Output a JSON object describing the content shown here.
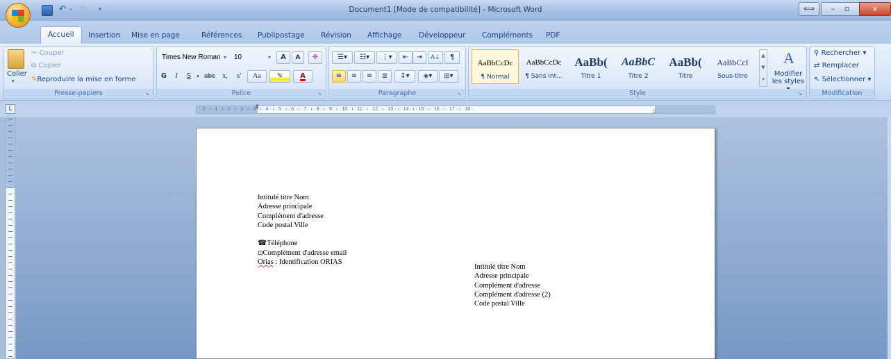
{
  "window": {
    "title": "Document1 [Mode de compatibilité] - Microsoft Word",
    "controls": {
      "restore": "⟺",
      "minimize": "–",
      "maximize": "▫",
      "close": "x"
    }
  },
  "tabs": [
    "Accueil",
    "Insertion",
    "Mise en page",
    "Références",
    "Publipostage",
    "Révision",
    "Affichage",
    "Développeur",
    "Compléments",
    "PDF"
  ],
  "clipboard": {
    "paste": "Coller",
    "cut": "Couper",
    "copy": "Copier",
    "format_painter": "Reproduire la mise en forme",
    "label": "Presse-papiers"
  },
  "font": {
    "family": "Times New Roman",
    "size": "10",
    "grow": "A",
    "shrink": "A",
    "bold": "G",
    "italic": "I",
    "underline": "S",
    "strike": "abc",
    "subscript": "x,",
    "superscript": "x'",
    "case": "Aa",
    "color": "A",
    "label": "Police"
  },
  "paragraph": {
    "sort": "A↓",
    "show_marks": "¶",
    "label": "Paragraphe"
  },
  "styles": {
    "items": [
      {
        "preview": "AaBbCcDc",
        "name": "¶ Normal"
      },
      {
        "preview": "AaBbCcDc",
        "name": "¶ Sans int..."
      },
      {
        "preview": "AaBb(",
        "name": "Titre 1"
      },
      {
        "preview": "AaBbC",
        "name": "Titre 2"
      },
      {
        "preview": "AaBb(",
        "name": "Titre"
      },
      {
        "preview": "AaBbCcI",
        "name": "Sous-titre"
      }
    ],
    "modify_line1": "Modifier",
    "modify_line2": "les styles",
    "label": "Style"
  },
  "editing": {
    "find": "Rechercher",
    "replace": "Remplacer",
    "select": "Sélectionner",
    "label": "Modification"
  },
  "ruler": {
    "numbers": "· 2 · ı · 1 · ı · 1 · ı · 2 · ı · 3 · ı · 4 · ı · 5 · ı · 6 · ı · 7 · ı · 8 · ı · 9 · ı · 10 · ı · 11 · ı · 12 · ı · 13 · ı · 14 · ı · 15 · ı · 16 · ı · 17 · ı · 18 ·"
  },
  "document": {
    "sender": [
      "Intitulé titre Nom",
      "Adresse principale",
      "Complément d'adresse",
      "Code postal  Ville"
    ],
    "phone": "Téléphone",
    "email": "Complément d'adresse email",
    "orias_word": "Orias",
    "orias_rest": " : Identification ORIAS",
    "recipient": [
      "Intitulé titre Nom",
      "Adresse principale",
      "Complément d'adresse",
      "Complément d'adresse (2)",
      "Code postal Ville"
    ]
  },
  "colors": {
    "ribbon": "#dbe7f7",
    "workspace": "#8fabd3",
    "accent": "#15428b"
  }
}
